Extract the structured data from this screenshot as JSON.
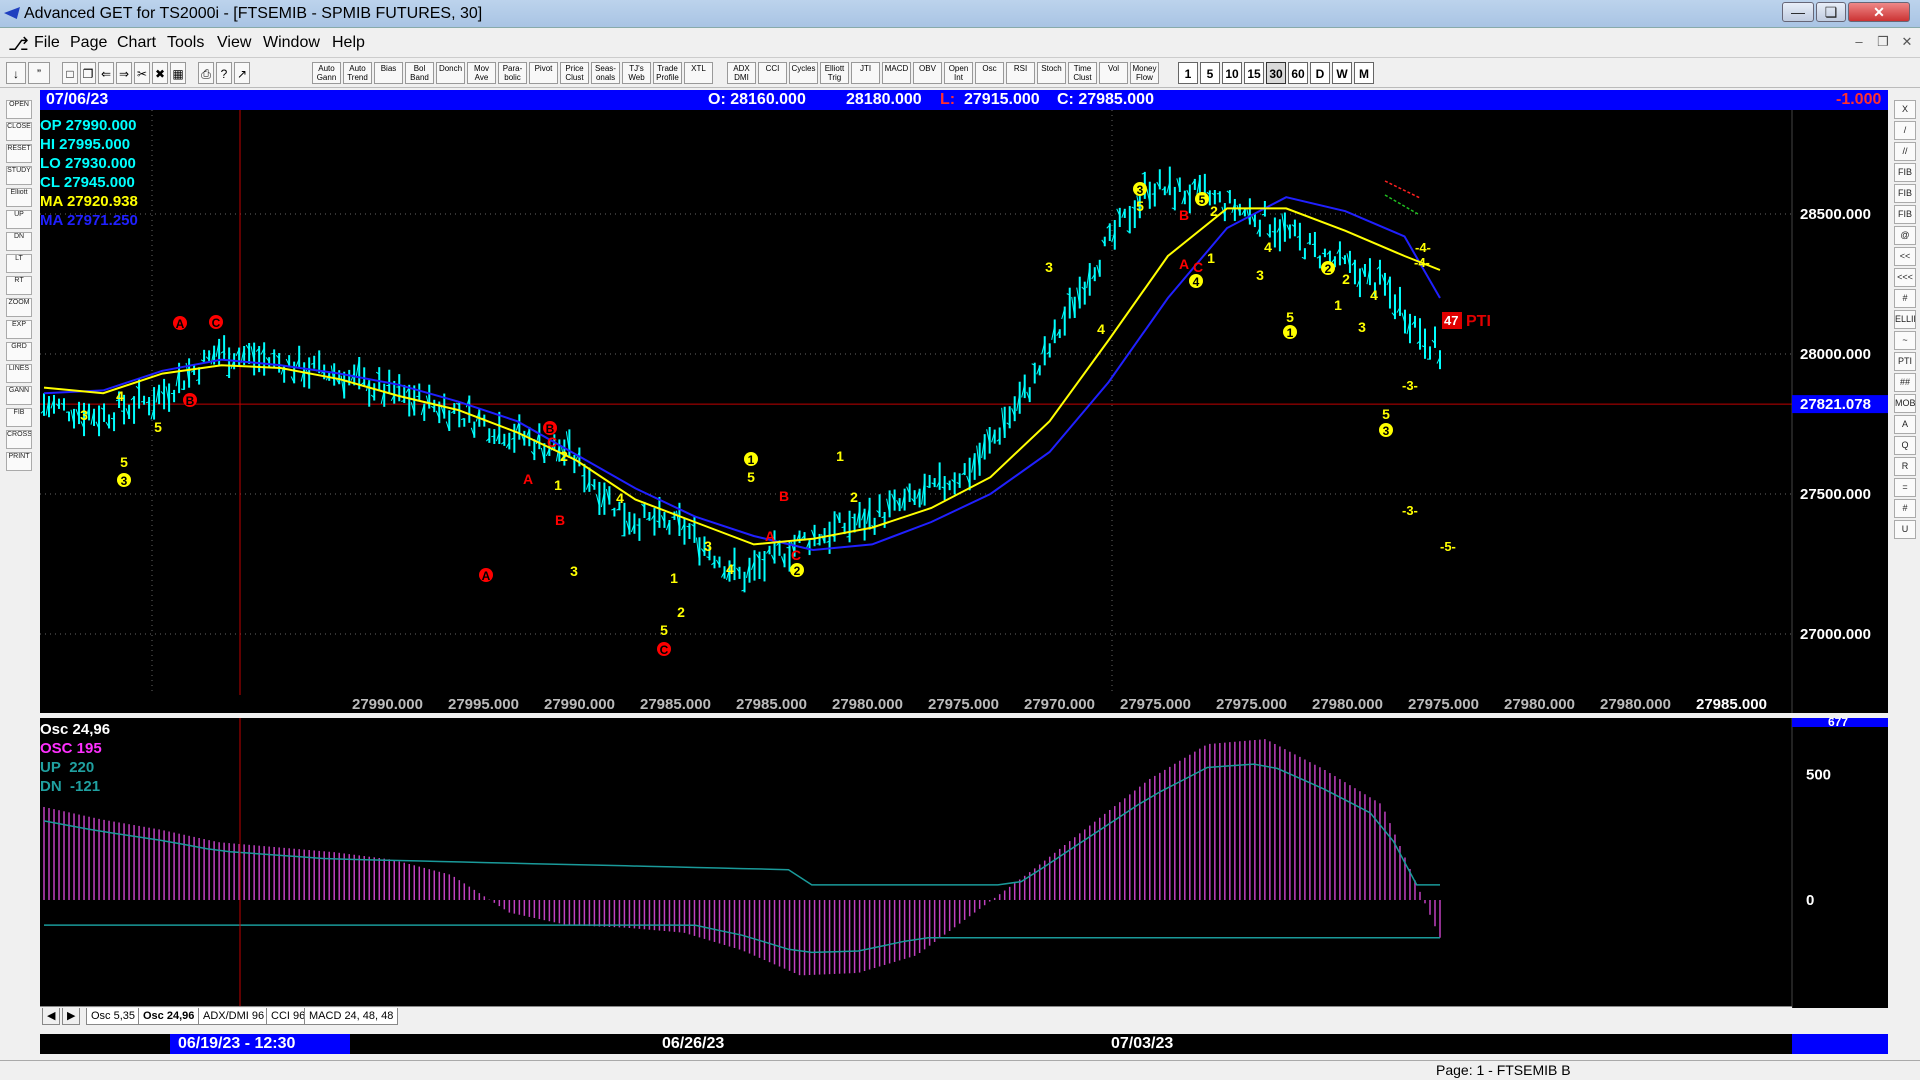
{
  "window": {
    "title": "Advanced GET for TS2000i - [FTSEMIB - SPMIB FUTURES, 30]"
  },
  "menu": [
    "File",
    "Page",
    "Chart",
    "Tools",
    "View",
    "Window",
    "Help"
  ],
  "toolbar": {
    "studies": [
      "Auto Gann",
      "Auto Trend",
      "Bias",
      "Bol Band",
      "Donch",
      "Mov Ave",
      "Para-bolic",
      "Pivot",
      "Price Clust",
      "Seas-onals",
      "TJ's Web",
      "Trade Profile",
      "XTL",
      "ADX DMI",
      "CCI",
      "Cycles",
      "Elliott Trig",
      "JTI",
      "MACD",
      "OBV",
      "Open Int",
      "Osc",
      "RSI",
      "Stoch",
      "Time Clust",
      "Vol",
      "Money Flow"
    ],
    "periods": [
      "1",
      "5",
      "10",
      "15",
      "30",
      "60",
      "D",
      "W",
      "M"
    ],
    "selected_period": "30"
  },
  "left_tools": [
    "OPEN",
    "CLOSE",
    "RESET",
    "STUDY",
    "Elliott",
    "UP",
    "DN",
    "LT",
    "RT",
    "ZOOM",
    "EXP",
    "GRD",
    "LINES",
    "GANN",
    "FIB",
    "CROSS",
    "PRINT"
  ],
  "right_tools": [
    "X",
    "/",
    "//",
    "FIB RET",
    "FIB EXT",
    "FIB TIME",
    "@",
    "<<",
    "<<<",
    "#",
    "ELLIPS",
    "~",
    "PTI",
    "##",
    "MOB",
    "A",
    "Q",
    "R",
    "=",
    "#",
    "U"
  ],
  "info_bar": {
    "date": "07/06/23",
    "open": "O: 28160.000",
    "high": "28180.000",
    "low_label": "L:",
    "low": "27915.000",
    "close": "C: 27985.000",
    "change": "-1.000"
  },
  "legend": {
    "op": "OP  27990.000",
    "hi": "HI   27995.000",
    "lo": "LO  27930.000",
    "cl": "CL  27945.000",
    "ma1": "MA  27920.938",
    "ma2": "MA  27971.250"
  },
  "price_axis": {
    "labels": [
      "28500.000",
      "28000.000",
      "27500.000",
      "27000.000"
    ],
    "current": "27821.078"
  },
  "bottom_prices": [
    "27990.000",
    "27995.000",
    "27990.000",
    "27985.000",
    "27985.000",
    "27980.000",
    "27975.000",
    "27970.000",
    "27975.000",
    "27975.000",
    "27980.000",
    "27975.000",
    "27980.000",
    "27980.000",
    "27985.000"
  ],
  "pti": {
    "value": "47",
    "label": "PTI"
  },
  "projections": [
    "-4-",
    "-4-",
    "-3-",
    "-3-",
    "-5-"
  ],
  "osc_legend": {
    "title": "Osc 24,96",
    "osc": "OSC 195",
    "up_label": "UP",
    "up": "220",
    "dn_label": "DN",
    "dn": "-121"
  },
  "osc_axis": {
    "top": "677",
    "mid": "500",
    "zero": "0"
  },
  "tabs": [
    "Osc 5,35",
    "Osc 24,96",
    "ADX/DMI 96",
    "CCI 96",
    "MACD 24, 48, 48"
  ],
  "active_tab": "Osc 24,96",
  "dates": {
    "cursor": "06/19/23 - 12:30",
    "d2": "06/26/23",
    "d3": "07/03/23"
  },
  "status": {
    "page": "Page: 1 - FTSEMIB B"
  },
  "chart_data": {
    "type": "line",
    "xlabel": "",
    "ylabel": "",
    "ylim": [
      26800,
      28800
    ],
    "x": [
      0,
      5,
      10,
      15,
      20,
      25,
      30,
      35,
      40,
      45,
      50,
      55,
      60,
      65,
      70,
      75,
      80,
      85,
      90,
      95,
      100,
      105,
      110,
      115,
      118
    ],
    "series": [
      {
        "values": [
          27820,
          27780,
          27850,
          28010,
          27970,
          27930,
          27860,
          27800,
          27720,
          27650,
          27420,
          27380,
          27200,
          27330,
          27400,
          27480,
          27600,
          27900,
          28300,
          28600,
          28560,
          28480,
          28350,
          28250,
          28000
        ]
      },
      {
        "values": [
          27880,
          27860,
          27930,
          27960,
          27950,
          27910,
          27850,
          27800,
          27720,
          27620,
          27480,
          27400,
          27320,
          27340,
          27380,
          27450,
          27560,
          27760,
          28050,
          28350,
          28520,
          28520,
          28440,
          28350,
          28300
        ]
      },
      {
        "values": [
          27860,
          27870,
          27940,
          27980,
          27960,
          27930,
          27890,
          27830,
          27760,
          27640,
          27520,
          27420,
          27350,
          27300,
          27320,
          27400,
          27500,
          27650,
          27900,
          28200,
          28450,
          28560,
          28510,
          28420,
          28200
        ]
      }
    ],
    "osc_values": [
      370,
      320,
      280,
      230,
      210,
      190,
      160,
      100,
      -50,
      -100,
      -110,
      -130,
      -200,
      -300,
      -290,
      -220,
      -50,
      120,
      300,
      480,
      620,
      640,
      520,
      380,
      -150
    ]
  }
}
